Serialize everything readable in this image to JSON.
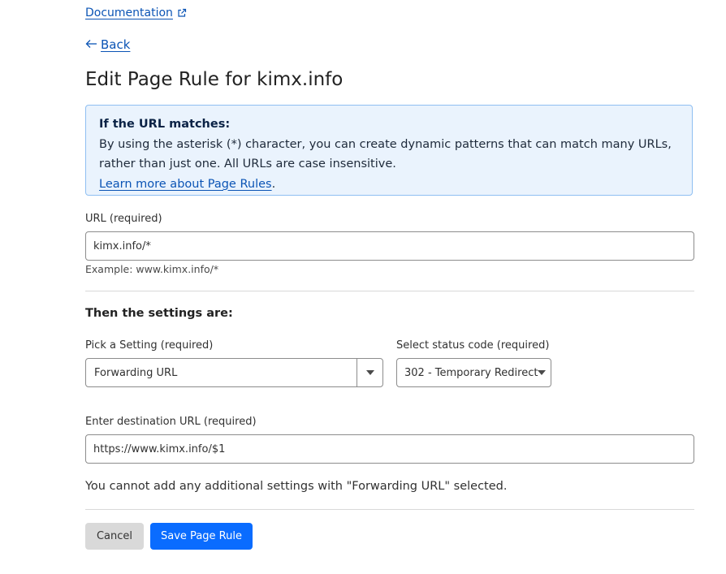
{
  "links": {
    "documentation": "Documentation",
    "back": "Back"
  },
  "page": {
    "title": "Edit Page Rule for kimx.info"
  },
  "info_box": {
    "heading": "If the URL matches:",
    "body": "By using the asterisk (*) character, you can create dynamic patterns that can match many URLs, rather than just one. All URLs are case insensitive.",
    "link": "Learn more about Page Rules",
    "link_suffix": "."
  },
  "url_field": {
    "label": "URL (required)",
    "value": "kimx.info/*",
    "example": "Example: www.kimx.info/*"
  },
  "settings": {
    "heading": "Then the settings are:",
    "setting_label": "Pick a Setting (required)",
    "setting_value": "Forwarding URL",
    "status_label": "Select status code (required)",
    "status_value": "302 - Temporary Redirect"
  },
  "destination_field": {
    "label": "Enter destination URL (required)",
    "value": "https://www.kimx.info/$1"
  },
  "note": "You cannot add any additional settings with \"Forwarding URL\" selected.",
  "buttons": {
    "cancel": "Cancel",
    "save": "Save Page Rule"
  },
  "icons": {
    "documentation": "external-link-icon",
    "back": "arrow-left-icon",
    "setting_dropdown": "caret-down-icon",
    "status_dropdown": "caret-down-icon"
  },
  "colors": {
    "link": "#0b54b5",
    "primary_button": "#0a6cff",
    "info_background": "#eaf3fd",
    "info_border": "#8fbff2"
  }
}
